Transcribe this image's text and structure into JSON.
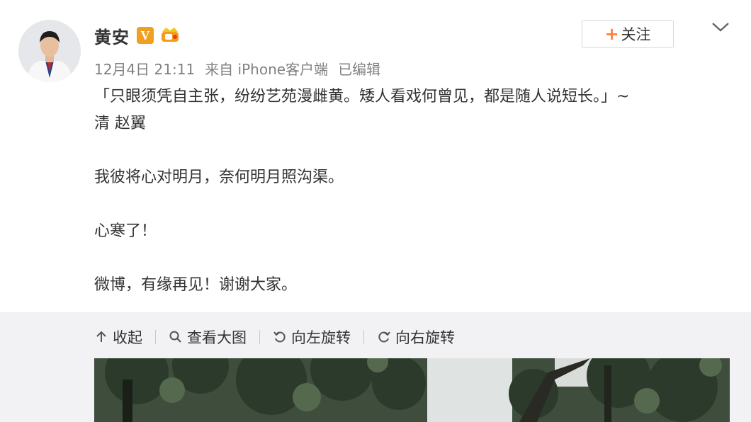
{
  "user": {
    "name": "黄安",
    "verified_badge": "V",
    "level_badge_icon": "vip-level-icon",
    "avatar_icon": "user-avatar"
  },
  "meta": {
    "date": "12月4日",
    "time": "21:11",
    "source": "来自 iPhone客户端",
    "edited": "已编辑"
  },
  "follow": {
    "plus": "+",
    "label": "关注"
  },
  "more_icon": "chevron-down-icon",
  "post": {
    "line1": "「只眼须凭自主张，纷纷艺苑漫雌黄。矮人看戏何曾见，都是随人说短长。」~",
    "line2": "清 赵翼",
    "para2": "我彼将心对明月，奈何明月照沟渠。",
    "para3": "心寒了！",
    "para4": "微博，有缘再见！谢谢大家。"
  },
  "toolbar": {
    "collapse": "收起",
    "view_large": "查看大图",
    "rotate_left": "向左旋转",
    "rotate_right": "向右旋转"
  },
  "colors": {
    "accent_orange": "#ff8140",
    "badge_gold": "#f0a020",
    "meta_gray": "#808080",
    "panel_bg": "#f2f2f5"
  }
}
